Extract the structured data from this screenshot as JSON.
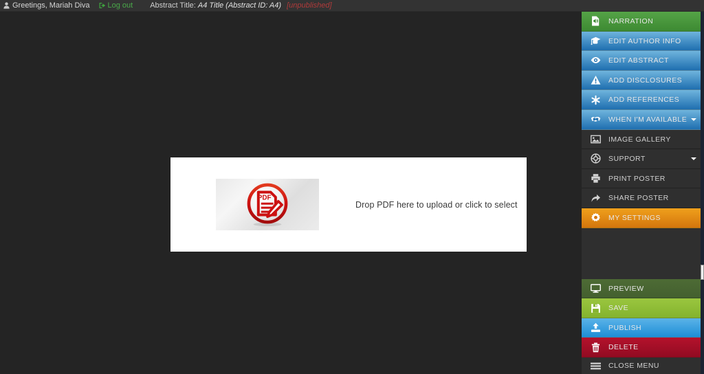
{
  "topbar": {
    "user_icon": "user-icon",
    "greeting": "Greetings, Mariah Diva",
    "logout_icon": "logout-arrow-icon",
    "logout_label": "Log out",
    "abstract_prefix": "Abstract Title:",
    "abstract_title": "A4 Title (Abstract ID: A4)",
    "status": "[unpublished]",
    "status_color": "#b03a3a",
    "background": "#333333"
  },
  "main": {
    "background": "#242424",
    "upload": {
      "thumb_icon": "pdf-document-icon",
      "dropzone_text": "Drop PDF here to upload or click to select",
      "panel_background": "#ffffff",
      "accent_color": "#cc1111"
    }
  },
  "sidebar": {
    "background": "#2f2f2f",
    "items": [
      {
        "label": "NARRATION",
        "icon": "narration-audio-document-icon",
        "theme": "t-green",
        "caret": false
      },
      {
        "label": "EDIT AUTHOR INFO",
        "icon": "graduation-cap-icon",
        "theme": "t-blue",
        "caret": false
      },
      {
        "label": "EDIT ABSTRACT",
        "icon": "eye-icon",
        "theme": "t-blue",
        "caret": false
      },
      {
        "label": "ADD DISCLOSURES",
        "icon": "warning-triangle-icon",
        "theme": "t-blue",
        "caret": false
      },
      {
        "label": "ADD REFERENCES",
        "icon": "asterisk-icon",
        "theme": "t-blue",
        "caret": false
      },
      {
        "label": "WHEN I'M AVAILABLE",
        "icon": "handshake-icon",
        "theme": "t-blue",
        "caret": true
      },
      {
        "label": "IMAGE GALLERY",
        "icon": "image-icon",
        "theme": "t-dark",
        "caret": false
      },
      {
        "label": "SUPPORT",
        "icon": "life-ring-icon",
        "theme": "t-dark",
        "caret": true
      },
      {
        "label": "PRINT POSTER",
        "icon": "printer-icon",
        "theme": "t-dark",
        "caret": false
      },
      {
        "label": "SHARE POSTER",
        "icon": "share-arrow-icon",
        "theme": "t-dark",
        "caret": false
      },
      {
        "label": "MY SETTINGS",
        "icon": "gear-icon",
        "theme": "t-orange",
        "caret": false
      }
    ],
    "actions": [
      {
        "label": "PREVIEW",
        "icon": "monitor-icon",
        "theme": "t-preview"
      },
      {
        "label": "SAVE",
        "icon": "floppy-disk-icon",
        "theme": "t-save"
      },
      {
        "label": "PUBLISH",
        "icon": "upload-icon",
        "theme": "t-publish"
      },
      {
        "label": "DELETE",
        "icon": "trash-can-icon",
        "theme": "t-delete"
      }
    ],
    "close_menu": {
      "label": "CLOSE MENU",
      "icon": "hamburger-icon"
    }
  }
}
